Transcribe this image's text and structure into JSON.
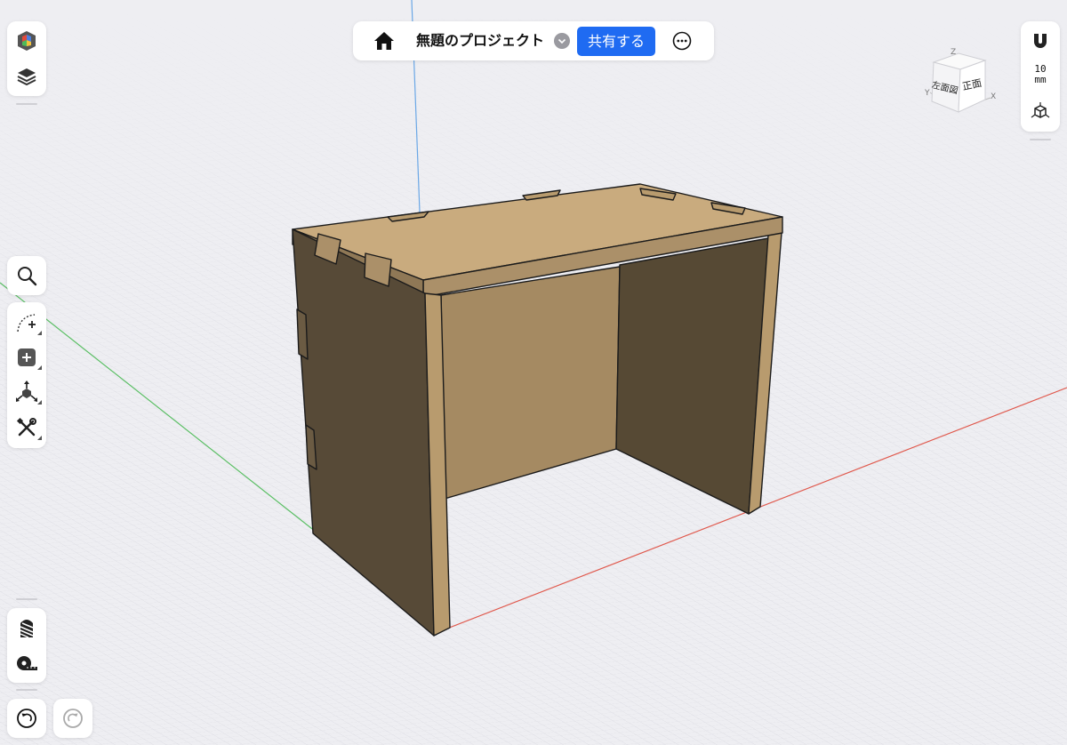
{
  "app": {
    "project_title": "無題のプロジェクト",
    "share_label": "共有する"
  },
  "right_toolbar": {
    "grid_value": "10",
    "grid_unit": "mm"
  },
  "view_cube": {
    "front_label": "正面",
    "left_label": "左面図",
    "x_label": "X",
    "y_label": "Y",
    "z_label": "Z"
  },
  "icons": {
    "home": "home-icon",
    "dropdown": "chevron-down-icon",
    "more": "more-icon",
    "object": "object-cube-icon",
    "layers": "layers-icon",
    "search": "search-icon",
    "sketch": "sketch-curve-icon",
    "add": "add-primitive-icon",
    "transform": "transform-icon",
    "tools": "tools-icon",
    "material": "material-stripes-icon",
    "measure": "tape-measure-icon",
    "undo": "undo-icon",
    "redo": "redo-icon",
    "snap": "snap-magnet-icon",
    "view": "view-cube-icon"
  },
  "colors": {
    "accent": "#1f6bf2",
    "wood_top": "#c9ab7e",
    "wood_side": "#574a37",
    "axis_x": "#e0594d",
    "axis_y": "#5bbf65",
    "axis_z": "#6aa7e6"
  }
}
